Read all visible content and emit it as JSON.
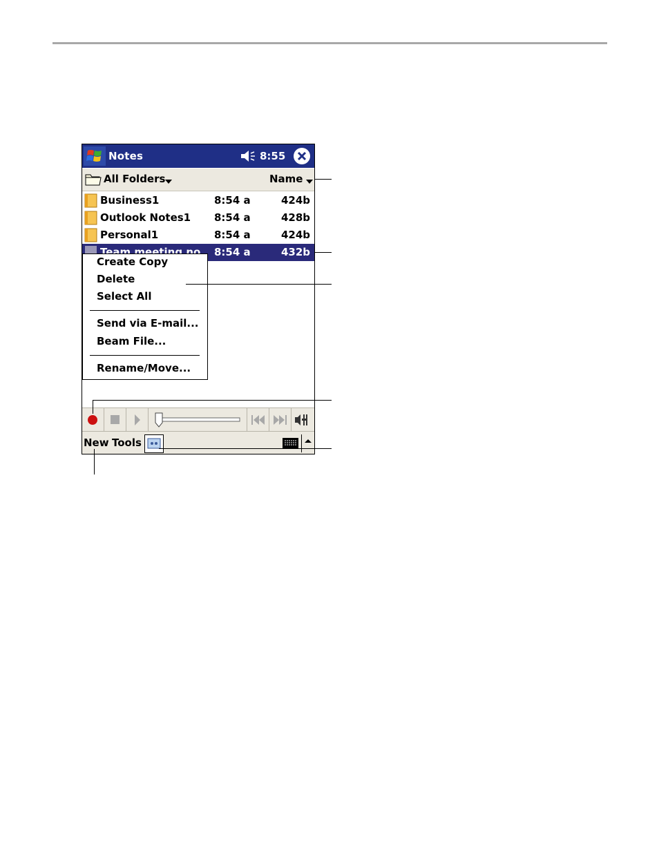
{
  "titlebar": {
    "app_title": "Notes",
    "time": "8:55",
    "icons": {
      "start": "windows-flag-icon",
      "volume": "speaker-icon",
      "close": "close-icon"
    }
  },
  "folderbar": {
    "folder_label": "All Folders",
    "sort_label": "Name"
  },
  "files": [
    {
      "name": "Business1",
      "time": "8:54 a",
      "size": "424b",
      "selected": false
    },
    {
      "name": "Outlook Notes1",
      "time": "8:54 a",
      "size": "428b",
      "selected": false
    },
    {
      "name": "Personal1",
      "time": "8:54 a",
      "size": "424b",
      "selected": false
    },
    {
      "name": "Team meeting no",
      "time": "8:54 a",
      "size": "432b",
      "selected": true
    }
  ],
  "context_menu": {
    "create_copy": "Create Copy",
    "delete": "Delete",
    "select_all": "Select All",
    "send_email": "Send via E-mail...",
    "beam_file": "Beam File...",
    "rename_move": "Rename/Move..."
  },
  "audio_toolbar": {
    "icons": [
      "record-icon",
      "stop-icon",
      "play-icon",
      "position-slider",
      "skip-back-icon",
      "skip-forward-icon",
      "volume-icon"
    ],
    "record_color": "#cc1010",
    "slider_position": 0.0
  },
  "menubar": {
    "new_label": "New",
    "tools_label": "Tools",
    "icons": {
      "recording": "recording-toolbar-icon",
      "keyboard": "keyboard-icon",
      "sip_arrow": "up-arrow-icon"
    }
  },
  "colors": {
    "title_bg": "#1f2f86",
    "selection_bg": "#2a2a7a",
    "bar_bg": "#ece9e0",
    "rule": "#a8a8a8"
  }
}
